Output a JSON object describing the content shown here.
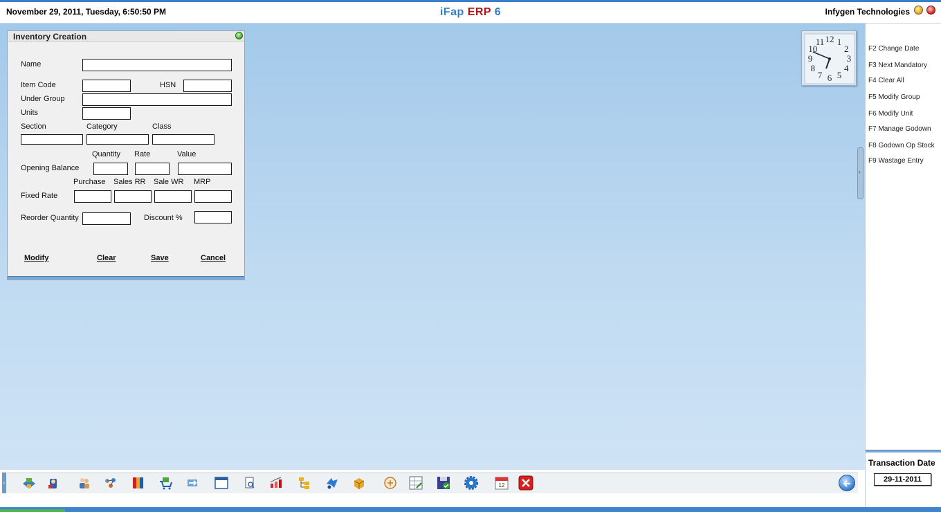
{
  "header": {
    "datetime": "November  29, 2011, Tuesday, 6:50:50 PM",
    "brand_part1": "iFap",
    "brand_part2": "ERP",
    "brand_part3": "6",
    "company": "Infygen Technologies",
    "colors": {
      "brand_blue": "#2f7fc6",
      "brand_red": "#b0171b"
    }
  },
  "form": {
    "title": "Inventory Creation",
    "labels": {
      "name": "Name",
      "item_code": "Item Code",
      "hsn": "HSN",
      "under_group": "Under Group",
      "units": "Units",
      "section": "Section",
      "category": "Category",
      "class": "Class",
      "quantity": "Quantity",
      "rate": "Rate",
      "value": "Value",
      "opening_balance": "Opening Balance",
      "purchase": "Purchase",
      "sales_rr": "Sales RR",
      "sale_wr": "Sale WR",
      "mrp": "MRP",
      "fixed_rate": "Fixed Rate",
      "reorder_quantity": "Reorder Quantity",
      "discount": "Discount %"
    },
    "values": {
      "name": "",
      "item_code": "",
      "hsn": "",
      "under_group": "",
      "units": "",
      "section": "",
      "category": "",
      "class": "",
      "quantity": "",
      "rate": "",
      "value": "",
      "purchase": "",
      "sales_rr": "",
      "sale_wr": "",
      "mrp": "",
      "reorder_quantity": "",
      "discount": ""
    },
    "buttons": {
      "modify": "Modify",
      "clear": "Clear",
      "save": "Save",
      "cancel": "Cancel"
    }
  },
  "shortcuts": [
    "F2 Change Date",
    "F3 Next Mandatory",
    "F4 Clear All",
    "F5 Modify Group",
    "F6 Modify Unit",
    "F7 Manage Godown",
    "F8 Godown Op Stock",
    "F9 Wastage Entry"
  ],
  "transaction": {
    "label": "Transaction Date",
    "date": "29-11-2011"
  },
  "clock": {
    "numerals": [
      "12",
      "1",
      "2",
      "3",
      "4",
      "5",
      "6",
      "7",
      "8",
      "9",
      "10",
      "11"
    ],
    "time": "6:50"
  },
  "toolbar": {
    "icons": [
      "accounts-icon",
      "contacts-icon",
      "users-icon",
      "network-icon",
      "books-icon",
      "shopping-cart-icon",
      "transfer-icon",
      "window-icon",
      "document-search-icon",
      "chart-icon",
      "hierarchy-icon",
      "routing-icon",
      "package-icon",
      "money-icon",
      "spreadsheet-icon",
      "backup-icon",
      "settings-icon",
      "calendar-icon",
      "exit-icon"
    ],
    "calendar_day": "12",
    "back_icon": "back-arrow-icon"
  }
}
